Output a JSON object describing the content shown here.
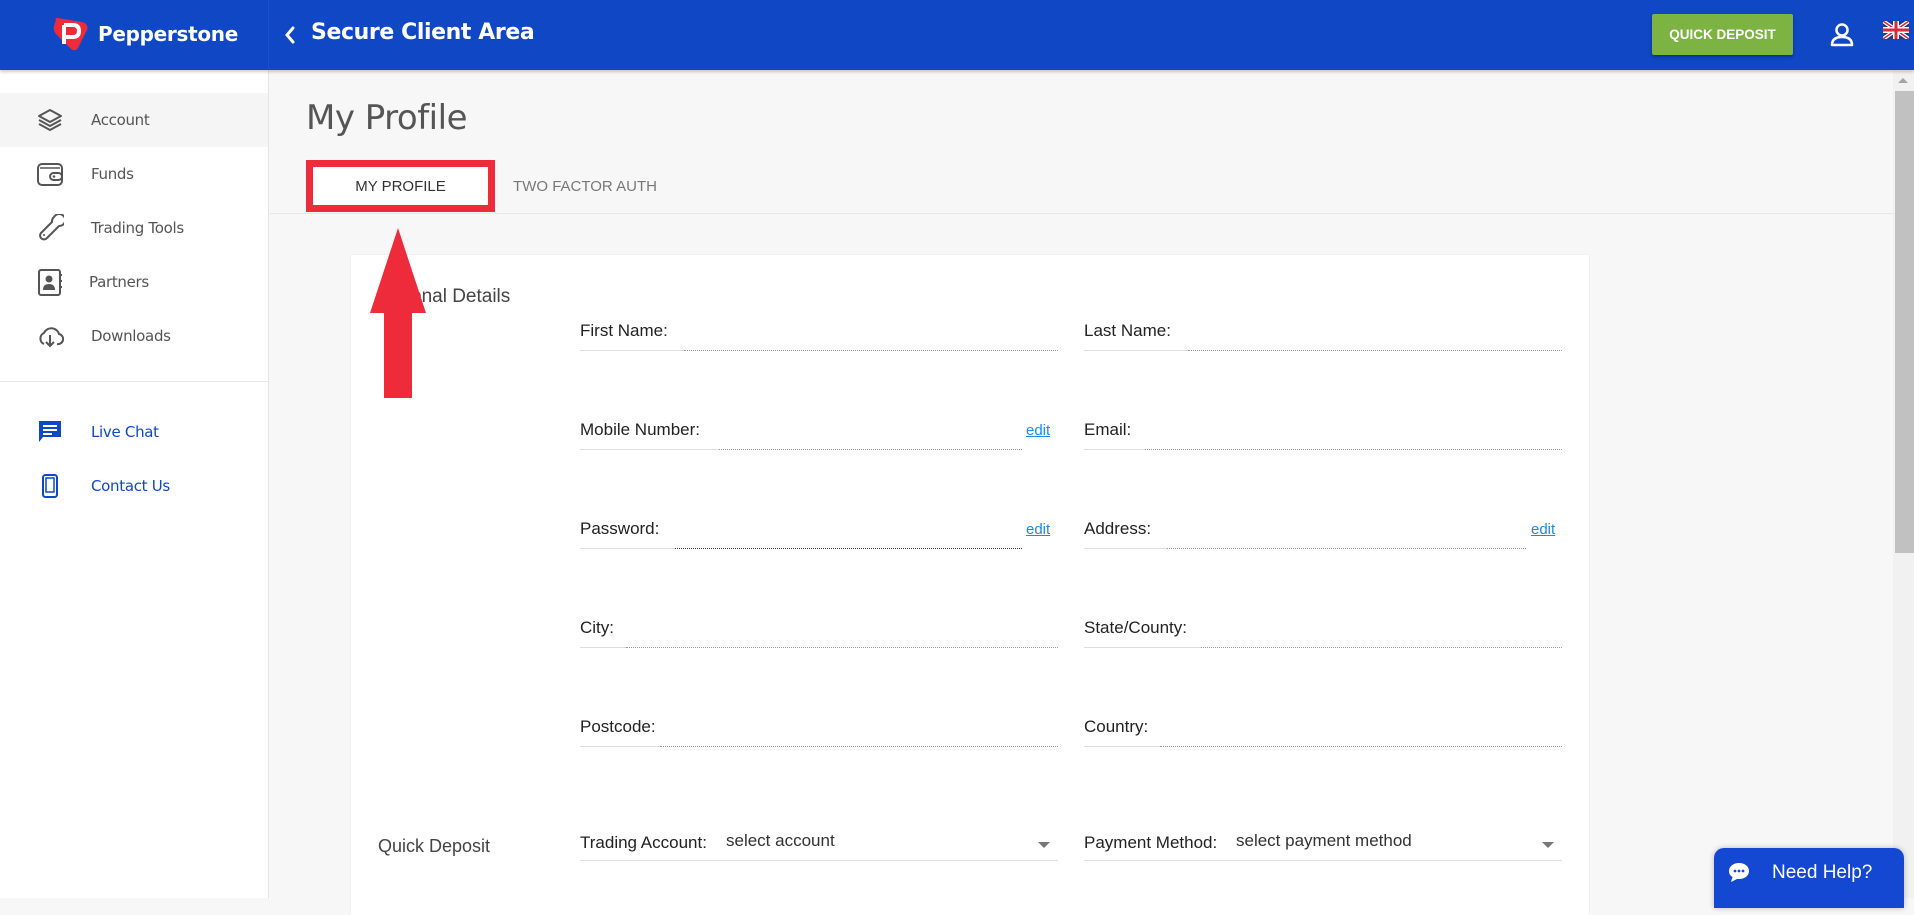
{
  "header": {
    "brand": "Pepperstone",
    "title": "Secure Client Area",
    "quick_deposit_label": "QUICK DEPOSIT",
    "brand_color": "#0f47c5",
    "accent_green": "#7cb342"
  },
  "sidebar": {
    "items": [
      {
        "label": "Account",
        "icon": "layers-icon",
        "active": true
      },
      {
        "label": "Funds",
        "icon": "wallet-icon"
      },
      {
        "label": "Trading Tools",
        "icon": "wrench-icon"
      },
      {
        "label": "Partners",
        "icon": "contact-book-icon"
      },
      {
        "label": "Downloads",
        "icon": "cloud-download-icon"
      }
    ],
    "support": [
      {
        "label": "Live Chat",
        "icon": "chat-icon"
      },
      {
        "label": "Contact Us",
        "icon": "phone-icon"
      }
    ]
  },
  "page": {
    "title": "My Profile",
    "tabs": [
      {
        "label": "MY PROFILE",
        "active": true
      },
      {
        "label": "TWO FACTOR AUTH",
        "active": false
      }
    ]
  },
  "personal_details": {
    "section_title_visible": "onal Details",
    "fields": {
      "first_name": {
        "label": "First Name:",
        "value": ""
      },
      "last_name": {
        "label": "Last Name:",
        "value": ""
      },
      "mobile": {
        "label": "Mobile Number:",
        "value": "",
        "edit_label": "edit"
      },
      "email": {
        "label": "Email:",
        "value": ""
      },
      "password": {
        "label": "Password:",
        "value": "",
        "edit_label": "edit"
      },
      "address": {
        "label": "Address:",
        "value": "",
        "edit_label": "edit"
      },
      "city": {
        "label": "City:",
        "value": ""
      },
      "state": {
        "label": "State/County:",
        "value": ""
      },
      "postcode": {
        "label": "Postcode:",
        "value": ""
      },
      "country": {
        "label": "Country:",
        "value": ""
      }
    }
  },
  "quick_deposit": {
    "section_title": "Quick Deposit",
    "trading_account": {
      "label": "Trading Account:",
      "value": "select account"
    },
    "payment_method": {
      "label": "Payment Method:",
      "value": "select payment method"
    }
  },
  "help_widget": {
    "label": "Need Help?"
  },
  "annotation": {
    "highlight_color": "#ee2b3b"
  }
}
